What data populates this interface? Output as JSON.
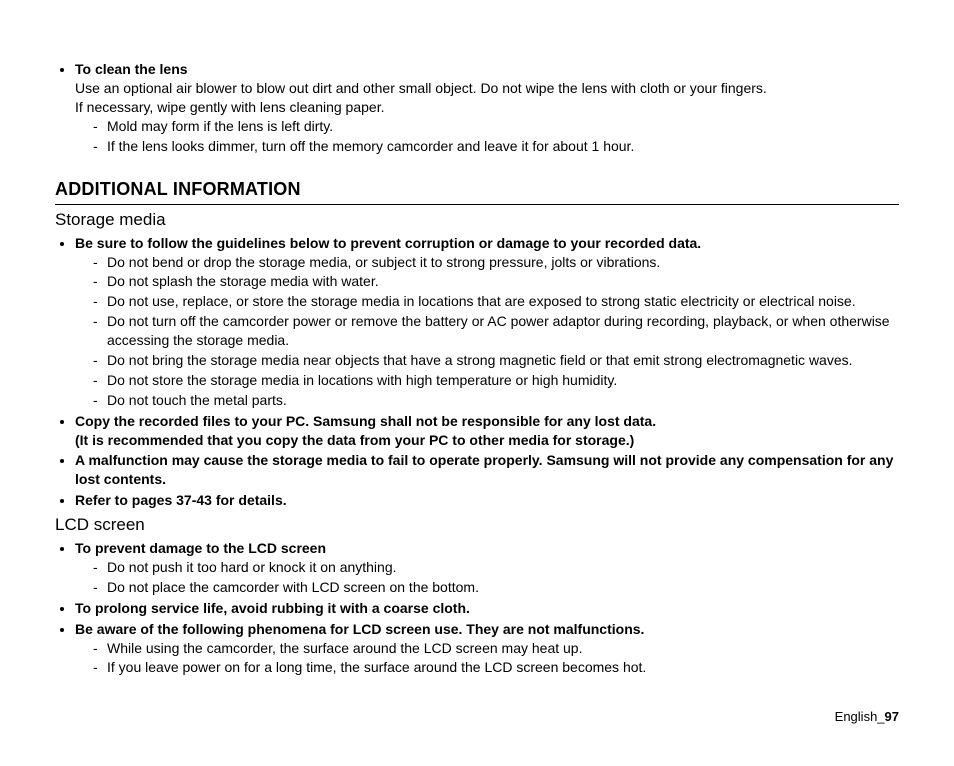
{
  "topSection": {
    "heading": "To clean the lens",
    "body1": "Use an optional air blower to blow out dirt and other small object. Do not wipe the lens with cloth or your fingers.",
    "body2": "If necessary, wipe gently with lens cleaning paper.",
    "dashes": [
      "Mold may form if the lens is left dirty.",
      "If the lens looks dimmer, turn off the memory camcorder and leave it for about 1 hour."
    ]
  },
  "additionalHeading": "ADDITIONAL INFORMATION",
  "storage": {
    "heading": "Storage media",
    "points": [
      {
        "bold": "Be sure to follow the guidelines below to prevent corruption or damage to your recorded data.",
        "dashes": [
          "Do not bend or drop the storage media, or subject it to strong pressure, jolts or vibrations.",
          "Do not splash the storage media with water.",
          "Do not use, replace, or store the storage media in locations that are exposed to strong static electricity or electrical noise.",
          "Do not turn off the camcorder power or remove the battery or AC power adaptor during recording, playback, or when otherwise accessing the storage media.",
          "Do not bring the storage media near objects that have a strong magnetic field or that emit strong electromagnetic waves.",
          "Do not store the storage media in locations with high temperature or high humidity.",
          "Do not touch the metal parts."
        ]
      },
      {
        "bold": "Copy the recorded files to your PC. Samsung shall not be responsible for any lost data.",
        "bold2": "(It is recommended that you copy the data from your PC to other media for storage.)"
      },
      {
        "bold": "A malfunction may cause the storage media to fail to operate properly. Samsung will not provide any compensation for any lost contents."
      },
      {
        "bold": "Refer to pages 37-43 for details."
      }
    ]
  },
  "lcd": {
    "heading": "LCD screen",
    "points": [
      {
        "bold": "To prevent damage to the LCD screen",
        "dashes": [
          "Do not push it too hard or knock it on anything.",
          "Do not place the camcorder with LCD screen on the bottom."
        ]
      },
      {
        "bold": "To prolong service life, avoid rubbing it with a coarse cloth."
      },
      {
        "bold": "Be aware of the following phenomena for LCD screen use. They are not malfunctions.",
        "dashes": [
          "While using the camcorder, the surface around the LCD screen may heat up.",
          "If you leave power on for a long time, the surface around the LCD screen becomes hot."
        ]
      }
    ]
  },
  "footer": {
    "lang": "English",
    "sep": "_",
    "page": "97"
  }
}
